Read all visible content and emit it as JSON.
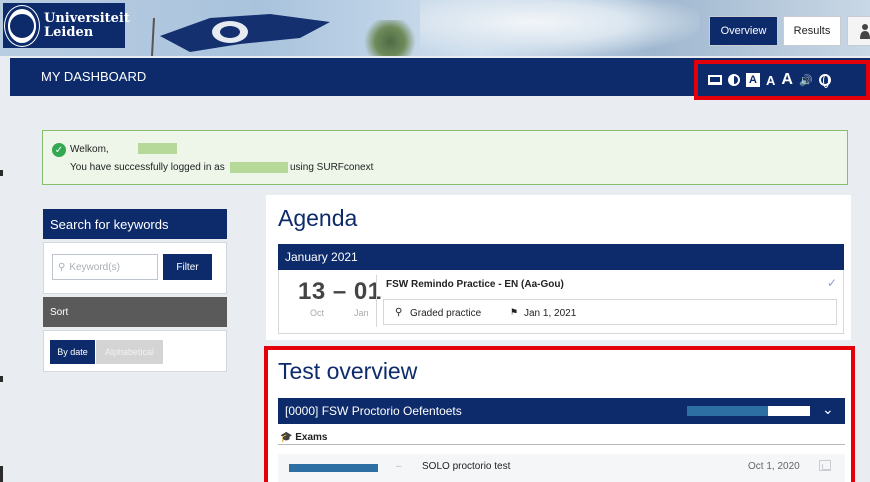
{
  "header": {
    "logo_line1": "Universiteit",
    "logo_line2": "Leiden",
    "nav": {
      "overview": "Overview",
      "results": "Results"
    }
  },
  "titlebar": {
    "title": "MY DASHBOARD",
    "accessibility_icons": [
      "laptop-icon",
      "contrast-icon",
      "font-a-boxed-icon",
      "font-a-icon",
      "font-a-large-icon",
      "speaker-icon",
      "globe-icon"
    ],
    "accessibility_letters": {
      "a_boxed": "A",
      "a": "A",
      "a_large": "A",
      "speaker": "🔊"
    }
  },
  "alert": {
    "welcome": "Welkom,",
    "logged_in_prefix": "You have successfully logged in as",
    "logged_in_suffix": "using SURFconext"
  },
  "sidebar": {
    "search_heading": "Search for keywords",
    "keyword_placeholder": "Keyword(s)",
    "filter_label": "Filter",
    "sort_heading": "Sort",
    "sort_options": [
      "By date",
      "Alphabetical"
    ],
    "sort_selected": "By date"
  },
  "agenda": {
    "title": "Agenda",
    "month": "January 2021",
    "event": {
      "date_range": "13 – 01",
      "month_start": "Oct",
      "month_end": "Jan",
      "title": "FSW Remindo Practice - EN (Aa-Gou)",
      "type": "Graded practice",
      "date": "Jan 1, 2021"
    }
  },
  "test_overview": {
    "title": "Test overview",
    "test_name": "[0000] FSW Proctorio Oefentoets",
    "progress": 0.66,
    "section": "Exams",
    "exams": [
      {
        "name": "SOLO proctorio test",
        "date": "Oct 1, 2020",
        "dash": "–"
      }
    ]
  },
  "colors": {
    "brand": "#0d2b6b",
    "highlight": "#e3000b",
    "success": "#34a853",
    "progress": "#2d6fa2"
  }
}
